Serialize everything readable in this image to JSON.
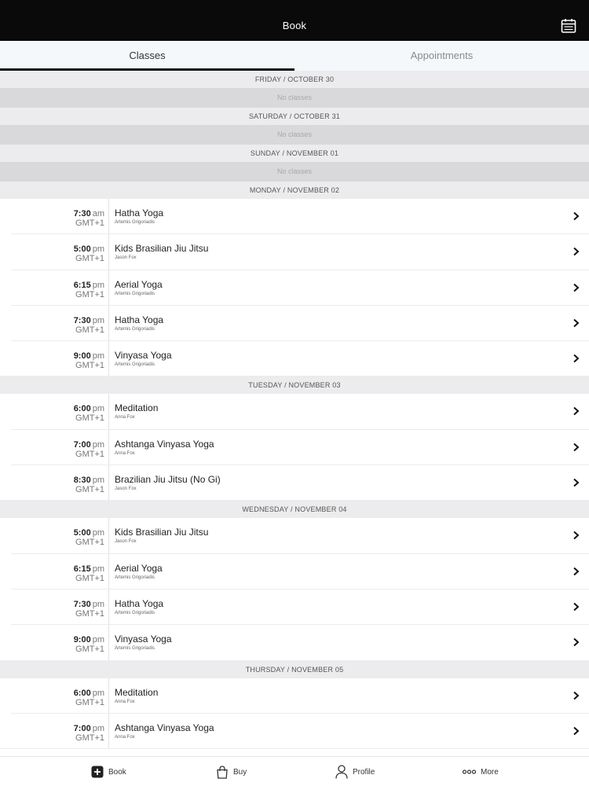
{
  "header": {
    "title": "Book",
    "calendar_icon": "calendar-icon"
  },
  "tabs": [
    {
      "label": "Classes",
      "active": true
    },
    {
      "label": "Appointments",
      "active": false
    }
  ],
  "days": [
    {
      "header": "FRIDAY / OCTOBER 30",
      "empty_text": "No classes",
      "classes": []
    },
    {
      "header": "SATURDAY / OCTOBER 31",
      "empty_text": "No classes",
      "classes": []
    },
    {
      "header": "SUNDAY / NOVEMBER 01",
      "empty_text": "No classes",
      "classes": []
    },
    {
      "header": "MONDAY / NOVEMBER 02",
      "classes": [
        {
          "time": "7:30",
          "ampm": "am",
          "tz": "GMT+1",
          "name": "Hatha Yoga",
          "instructor": "Artemis Grigoriadis"
        },
        {
          "time": "5:00",
          "ampm": "pm",
          "tz": "GMT+1",
          "name": "Kids Brasilian Jiu Jitsu",
          "instructor": "Jason Fox"
        },
        {
          "time": "6:15",
          "ampm": "pm",
          "tz": "GMT+1",
          "name": "Aerial Yoga",
          "instructor": "Artemis Grigoriadis"
        },
        {
          "time": "7:30",
          "ampm": "pm",
          "tz": "GMT+1",
          "name": "Hatha Yoga",
          "instructor": "Artemis Grigoriadis"
        },
        {
          "time": "9:00",
          "ampm": "pm",
          "tz": "GMT+1",
          "name": "Vinyasa Yoga",
          "instructor": "Artemis Grigoriadis"
        }
      ]
    },
    {
      "header": "TUESDAY / NOVEMBER 03",
      "classes": [
        {
          "time": "6:00",
          "ampm": "pm",
          "tz": "GMT+1",
          "name": "Meditation",
          "instructor": "Anna Fox"
        },
        {
          "time": "7:00",
          "ampm": "pm",
          "tz": "GMT+1",
          "name": "Ashtanga Vinyasa Yoga",
          "instructor": "Anna Fox"
        },
        {
          "time": "8:30",
          "ampm": "pm",
          "tz": "GMT+1",
          "name": "Brazilian Jiu Jitsu (No Gi)",
          "instructor": "Jason Fox"
        }
      ]
    },
    {
      "header": "WEDNESDAY / NOVEMBER 04",
      "classes": [
        {
          "time": "5:00",
          "ampm": "pm",
          "tz": "GMT+1",
          "name": "Kids Brasilian Jiu Jitsu",
          "instructor": "Jason Fox"
        },
        {
          "time": "6:15",
          "ampm": "pm",
          "tz": "GMT+1",
          "name": "Aerial Yoga",
          "instructor": "Artemis Grigoriadis"
        },
        {
          "time": "7:30",
          "ampm": "pm",
          "tz": "GMT+1",
          "name": "Hatha Yoga",
          "instructor": "Artemis Grigoriadis"
        },
        {
          "time": "9:00",
          "ampm": "pm",
          "tz": "GMT+1",
          "name": "Vinyasa Yoga",
          "instructor": "Artemis Grigoriadis"
        }
      ]
    },
    {
      "header": "THURSDAY / NOVEMBER 05",
      "classes": [
        {
          "time": "6:00",
          "ampm": "pm",
          "tz": "GMT+1",
          "name": "Meditation",
          "instructor": "Anna Fox"
        },
        {
          "time": "7:00",
          "ampm": "pm",
          "tz": "GMT+1",
          "name": "Ashtanga Vinyasa Yoga",
          "instructor": "Anna Fox"
        }
      ]
    }
  ],
  "bottom_nav": [
    {
      "label": "Book",
      "icon": "plus-square-icon",
      "active": true
    },
    {
      "label": "Buy",
      "icon": "shopping-bag-icon",
      "active": false
    },
    {
      "label": "Profile",
      "icon": "person-icon",
      "active": false
    },
    {
      "label": "More",
      "icon": "more-dots-icon",
      "active": false
    }
  ]
}
